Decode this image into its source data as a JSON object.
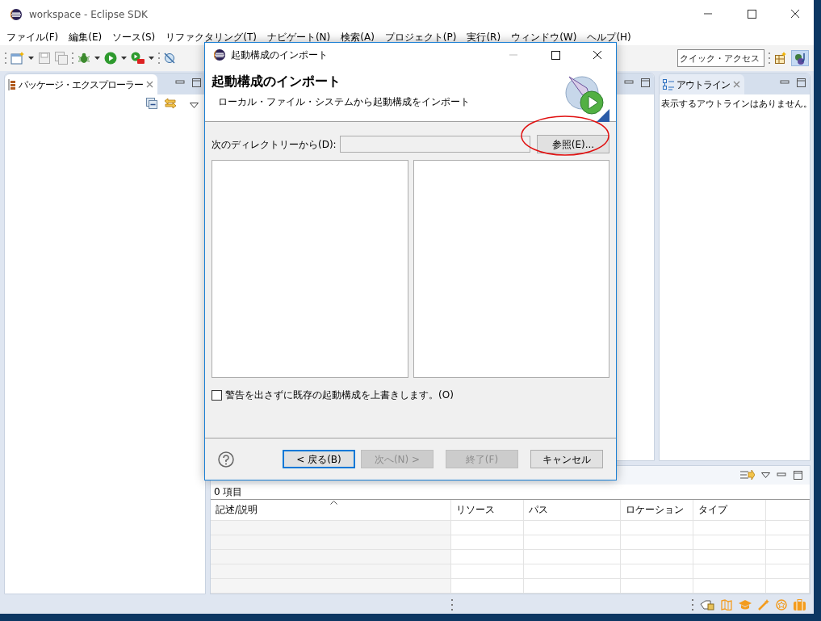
{
  "window": {
    "title": "workspace - Eclipse SDK"
  },
  "menu": [
    "ファイル(F)",
    "編集(E)",
    "ソース(S)",
    "リファクタリング(T)",
    "ナビゲート(N)",
    "検索(A)",
    "プロジェクト(P)",
    "実行(R)",
    "ウィンドウ(W)",
    "ヘルプ(H)"
  ],
  "quick_access": {
    "placeholder": "クイック・アクセス"
  },
  "package_explorer": {
    "tab": "パッケージ・エクスプローラー",
    "selected": true
  },
  "outline": {
    "tab": "アウトライン",
    "selected": false,
    "message": "表示するアウトラインはありません。"
  },
  "problems": {
    "count": "0 項目",
    "columns": [
      {
        "label": "記述/説明",
        "sorted": true
      },
      {
        "label": "リソース",
        "sorted": false
      },
      {
        "label": "パス",
        "sorted": false
      },
      {
        "label": "ロケーション",
        "sorted": false
      },
      {
        "label": "タイプ",
        "sorted": false
      }
    ]
  },
  "dialog": {
    "title": "起動構成のインポート",
    "heading": "起動構成のインポート",
    "description": "ローカル・ファイル・システムから起動構成をインポート",
    "directory_label": "次のディレクトリーから(D):",
    "browse_button": {
      "label": "参照(E)...",
      "circled": true
    },
    "overwrite": {
      "label": "警告を出さずに既存の起動構成を上書きします。(O)",
      "checked": false
    },
    "buttons": [
      {
        "label": "< 戻る(B)",
        "disabled": false,
        "focused": true
      },
      {
        "label": "次へ(N) >",
        "disabled": true,
        "focused": false
      },
      {
        "label": "終了(F)",
        "disabled": true,
        "focused": false
      },
      {
        "label": "キャンセル",
        "disabled": false,
        "focused": false
      }
    ]
  }
}
